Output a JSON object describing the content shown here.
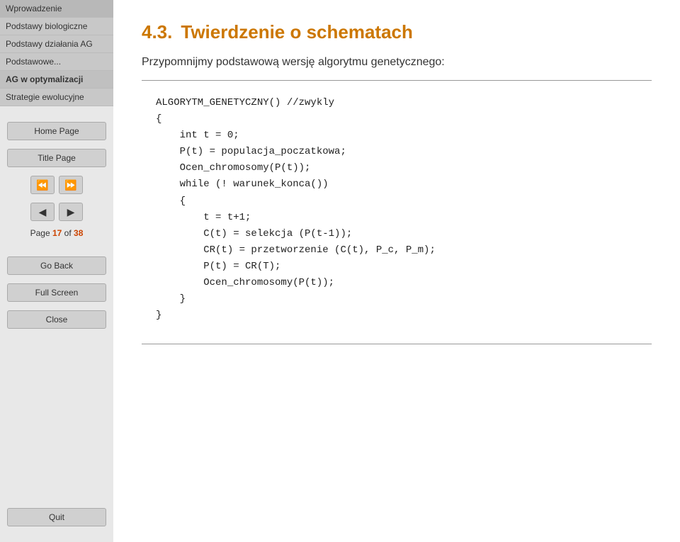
{
  "sidebar": {
    "nav_items": [
      {
        "id": "wprowadzenie",
        "label": "Wprowadzenie",
        "active": false
      },
      {
        "id": "podstawy-biologiczne",
        "label": "Podstawy biologiczne",
        "active": false
      },
      {
        "id": "podstawy-dzialania-ag",
        "label": "Podstawy działania AG",
        "active": false
      },
      {
        "id": "podstawowe",
        "label": "Podstawowe...",
        "active": false
      },
      {
        "id": "ag-w-optymalizacji",
        "label": "AG w optymalizacji",
        "active": true
      },
      {
        "id": "strategie-ewolucyjne",
        "label": "Strategie ewolucyjne",
        "active": false
      }
    ],
    "home_page_label": "Home Page",
    "title_page_label": "Title Page",
    "fast_back_icon": "⏪",
    "fast_forward_icon": "⏩",
    "back_icon": "◀",
    "forward_icon": "▶",
    "page_label": "Page",
    "page_current": "17",
    "page_of": "of",
    "page_total": "38",
    "go_back_label": "Go Back",
    "full_screen_label": "Full Screen",
    "close_label": "Close",
    "quit_label": "Quit"
  },
  "main": {
    "section_number": "4.3.",
    "section_title": "Twierdzenie o schematach",
    "intro_text": "Przypomnijmy podstawową wersję algorytmu genetycznego:",
    "code_lines": [
      "ALGORYTM_GENETYCZNY() //zwykly",
      "{",
      "    int t = 0;",
      "    P(t) = populacja_poczatkowa;",
      "    Ocen_chromosomy(P(t));",
      "    while (! warunek_konca())",
      "    {",
      "        t = t+1;",
      "        C(t) = selekcja (P(t-1));",
      "        CR(t) = przetworzenie (C(t), P_c, P_m);",
      "        P(t) = CR(T);",
      "        Ocen_chromosomy(P(t));",
      "    }",
      "}"
    ]
  },
  "colors": {
    "accent": "#cc7700",
    "highlight": "#cc4400"
  }
}
